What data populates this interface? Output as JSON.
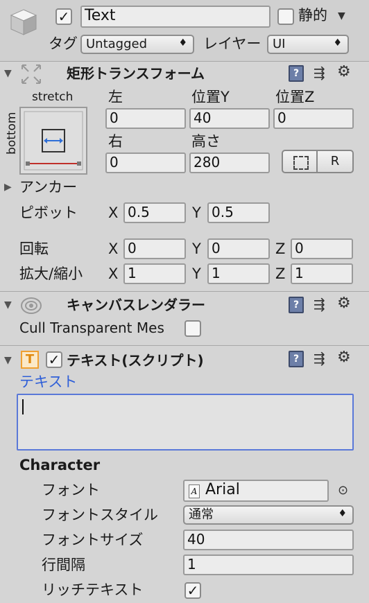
{
  "top": {
    "object_name": "Text",
    "static_label": "静的",
    "static_checked": false,
    "active_checked": true,
    "tag_label": "タグ",
    "tag_value": "Untagged",
    "layer_label": "レイヤー",
    "layer_value": "UI",
    "object_icon": "cube-icon",
    "dropdown_arrow": "▼",
    "select_arrow": "♦"
  },
  "rect_transform": {
    "title": "矩形トランスフォーム",
    "anchor_preset_top": "stretch",
    "anchor_preset_side": "bottom",
    "col1_label": "左",
    "col2_label": "位置Y",
    "col3_label": "位置Z",
    "left": "0",
    "pos_y": "40",
    "pos_z": "0",
    "row2_col1_label": "右",
    "row2_col2_label": "高さ",
    "right": "0",
    "height": "280",
    "raw_button": "R",
    "anchor_label": "アンカー",
    "pivot_label": "ピボット",
    "pivot_x": "0.5",
    "pivot_y": "0.5",
    "rotation_label": "回転",
    "rot_x": "0",
    "rot_y": "0",
    "rot_z": "0",
    "scale_label": "拡大/縮小",
    "scale_x": "1",
    "scale_y": "1",
    "scale_z": "1",
    "x_label": "X",
    "y_label": "Y",
    "z_label": "Z"
  },
  "canvas_renderer": {
    "title": "キャンバスレンダラー",
    "cull_label": "Cull Transparent Mes",
    "cull_checked": false
  },
  "text_component": {
    "title": "テキスト(スクリプト)",
    "enabled": true,
    "text_label": "テキスト",
    "text_value": "",
    "character_header": "Character",
    "font_label": "フォント",
    "font_value": "Arial",
    "font_style_label": "フォントスタイル",
    "font_style_value": "通常",
    "font_size_label": "フォントサイズ",
    "font_size_value": "40",
    "line_spacing_label": "行間隔",
    "line_spacing_value": "1",
    "rich_text_label": "リッチテキスト",
    "rich_text_checked": true
  },
  "icons": {
    "help": "?",
    "sliders": "⇶",
    "gear": "⚙",
    "collapse": "▼",
    "expand": "▶",
    "check": "✓",
    "target": "⊙"
  },
  "colors": {
    "background": "#d5d5d5",
    "field": "#ececec",
    "link_blue": "#2f5fd8",
    "text_area_border": "#5a78d8",
    "anchor_red": "#c0302a",
    "anchor_blue": "#2f6fd8",
    "component_text_icon": "#f0a030"
  }
}
